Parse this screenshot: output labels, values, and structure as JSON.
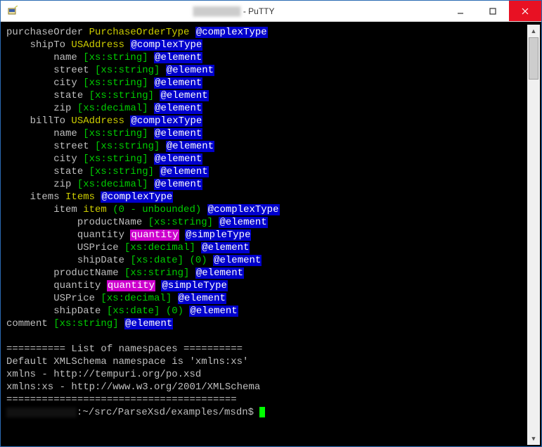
{
  "window": {
    "title_suffix": " - PuTTY"
  },
  "tree": [
    {
      "indent": 0,
      "name": "purchaseOrder",
      "type": "PurchaseOrderType",
      "anno": "@complexType"
    },
    {
      "indent": 1,
      "name": "shipTo",
      "type": "USAddress",
      "anno": "@complexType"
    },
    {
      "indent": 2,
      "name": "name",
      "xs": "[xs:string]",
      "anno": "@element"
    },
    {
      "indent": 2,
      "name": "street",
      "xs": "[xs:string]",
      "anno": "@element"
    },
    {
      "indent": 2,
      "name": "city",
      "xs": "[xs:string]",
      "anno": "@element"
    },
    {
      "indent": 2,
      "name": "state",
      "xs": "[xs:string]",
      "anno": "@element"
    },
    {
      "indent": 2,
      "name": "zip",
      "xs": "[xs:decimal]",
      "anno": "@element"
    },
    {
      "indent": 1,
      "name": "billTo",
      "type": "USAddress",
      "anno": "@complexType"
    },
    {
      "indent": 2,
      "name": "name",
      "xs": "[xs:string]",
      "anno": "@element"
    },
    {
      "indent": 2,
      "name": "street",
      "xs": "[xs:string]",
      "anno": "@element"
    },
    {
      "indent": 2,
      "name": "city",
      "xs": "[xs:string]",
      "anno": "@element"
    },
    {
      "indent": 2,
      "name": "state",
      "xs": "[xs:string]",
      "anno": "@element"
    },
    {
      "indent": 2,
      "name": "zip",
      "xs": "[xs:decimal]",
      "anno": "@element"
    },
    {
      "indent": 1,
      "name": "items",
      "type": "Items",
      "anno": "@complexType"
    },
    {
      "indent": 2,
      "name": "item",
      "type": "item",
      "card": "(0 - unbounded)",
      "anno": "@complexType"
    },
    {
      "indent": 3,
      "name": "productName",
      "xs": "[xs:string]",
      "anno": "@element"
    },
    {
      "indent": 3,
      "name": "quantity",
      "simple": "quantity",
      "anno": "@simpleType"
    },
    {
      "indent": 3,
      "name": "USPrice",
      "xs": "[xs:decimal]",
      "anno": "@element"
    },
    {
      "indent": 3,
      "name": "shipDate",
      "xs": "[xs:date]",
      "card": "(0)",
      "anno": "@element"
    },
    {
      "indent": 2,
      "name": "productName",
      "xs": "[xs:string]",
      "anno": "@element"
    },
    {
      "indent": 2,
      "name": "quantity",
      "simple": "quantity",
      "anno": "@simpleType"
    },
    {
      "indent": 2,
      "name": "USPrice",
      "xs": "[xs:decimal]",
      "anno": "@element"
    },
    {
      "indent": 2,
      "name": "shipDate",
      "xs": "[xs:date]",
      "card": "(0)",
      "anno": "@element"
    },
    {
      "indent": 0,
      "name": "comment",
      "xs": "[xs:string]",
      "anno": "@element"
    }
  ],
  "footer": {
    "blank": "",
    "sep": "========== List of namespaces ==========",
    "l1": "Default XMLSchema namespace is 'xmlns:xs'",
    "l2": "xmlns - http://tempuri.org/po.xsd",
    "l3": "xmlns:xs - http://www.w3.org/2001/XMLSchema",
    "rule": "=======================================",
    "prompt_path": ":~/src/ParseXsd/examples/msdn$ "
  }
}
